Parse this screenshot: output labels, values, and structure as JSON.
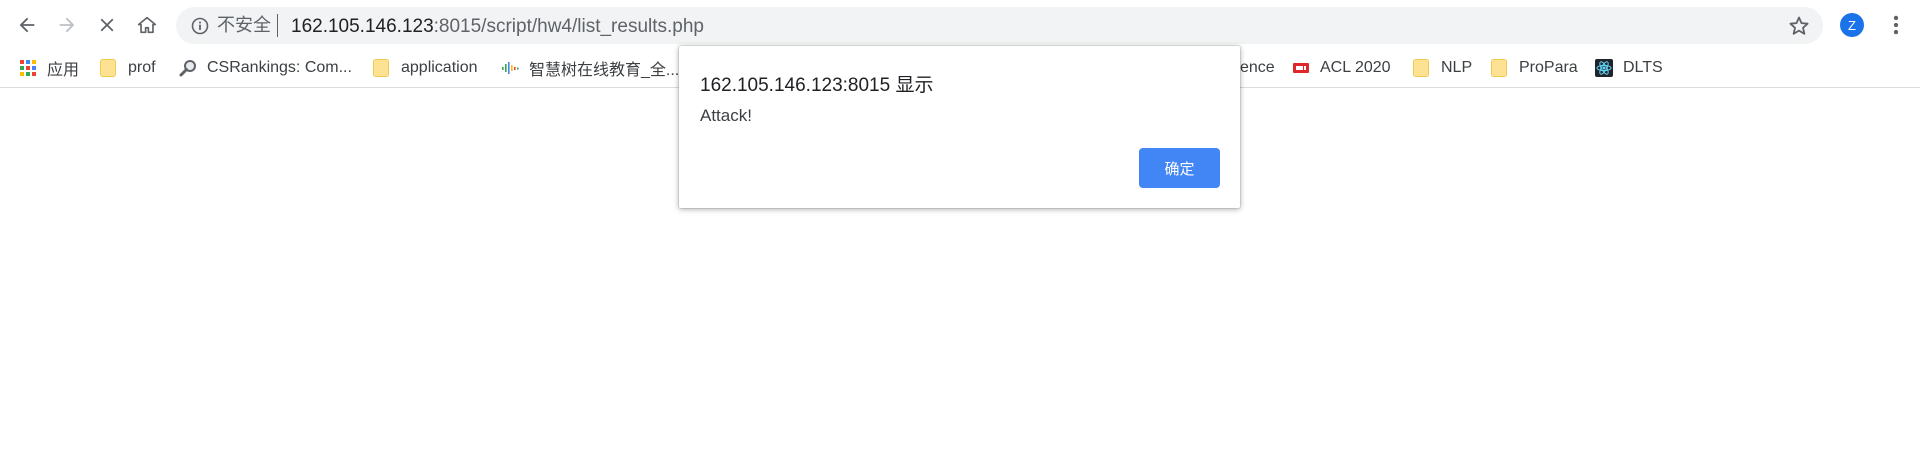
{
  "toolbar": {
    "security_label": "不安全",
    "url_host": "162.105.146.123",
    "url_rest": ":8015/script/hw4/list_results.php",
    "avatar_letter": "Z"
  },
  "bookmarks": [
    {
      "label": "应用",
      "icon": "apps-grid-icon"
    },
    {
      "label": "prof",
      "icon": "folder-icon"
    },
    {
      "label": "CSRankings: Com...",
      "icon": "magnifier-icon"
    },
    {
      "label": "application",
      "icon": "folder-icon"
    },
    {
      "label": "智慧树在线教育_全...",
      "icon": "soundwave-icon"
    },
    {
      "label": "ence",
      "icon": ""
    },
    {
      "label": "ACL 2020",
      "icon": "acl-logo-icon"
    },
    {
      "label": "NLP",
      "icon": "folder-icon"
    },
    {
      "label": "ProPara",
      "icon": "folder-icon"
    },
    {
      "label": "DLTS",
      "icon": "react-logo-icon"
    }
  ],
  "dialog": {
    "title": "162.105.146.123:8015 显示",
    "message": "Attack!",
    "ok_label": "确定"
  },
  "colors": {
    "accent": "#4285f4",
    "omnibox_bg": "#f1f3f4",
    "folder": "#fde293",
    "acl_red": "#e0262a",
    "avatar": "#1a73e8"
  }
}
